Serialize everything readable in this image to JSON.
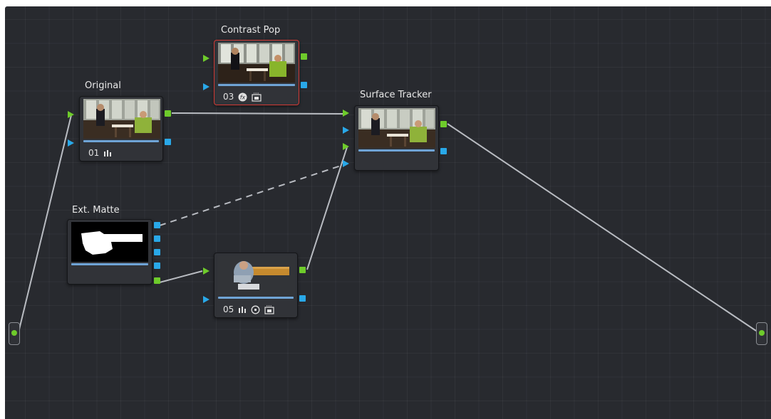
{
  "nodes": {
    "original": {
      "label": "Original",
      "number": "01",
      "tools": [
        "curves-icon"
      ]
    },
    "contrast_pop": {
      "label": "Contrast Pop",
      "number": "03",
      "tools": [
        "fx-icon",
        "key-image-icon"
      ],
      "selected": true
    },
    "surface_tracker": {
      "label": "Surface Tracker",
      "number": "",
      "tools": []
    },
    "ext_matte": {
      "label": "Ext. Matte",
      "number": "",
      "tools": []
    },
    "node_05": {
      "label": "",
      "number": "05",
      "tools": [
        "curves-icon",
        "circle-window-icon",
        "key-image-icon"
      ]
    }
  },
  "io": {
    "source_input": "source-input",
    "output": "node-tree-output"
  },
  "colors": {
    "background": "#282a2f",
    "node": "#313338",
    "rgb_port": "#6ecb2b",
    "key_port": "#29a8e8",
    "selected_border": "#d23a35",
    "wire": "#b9bcc2",
    "progress_bar": "#6fa4d6"
  }
}
